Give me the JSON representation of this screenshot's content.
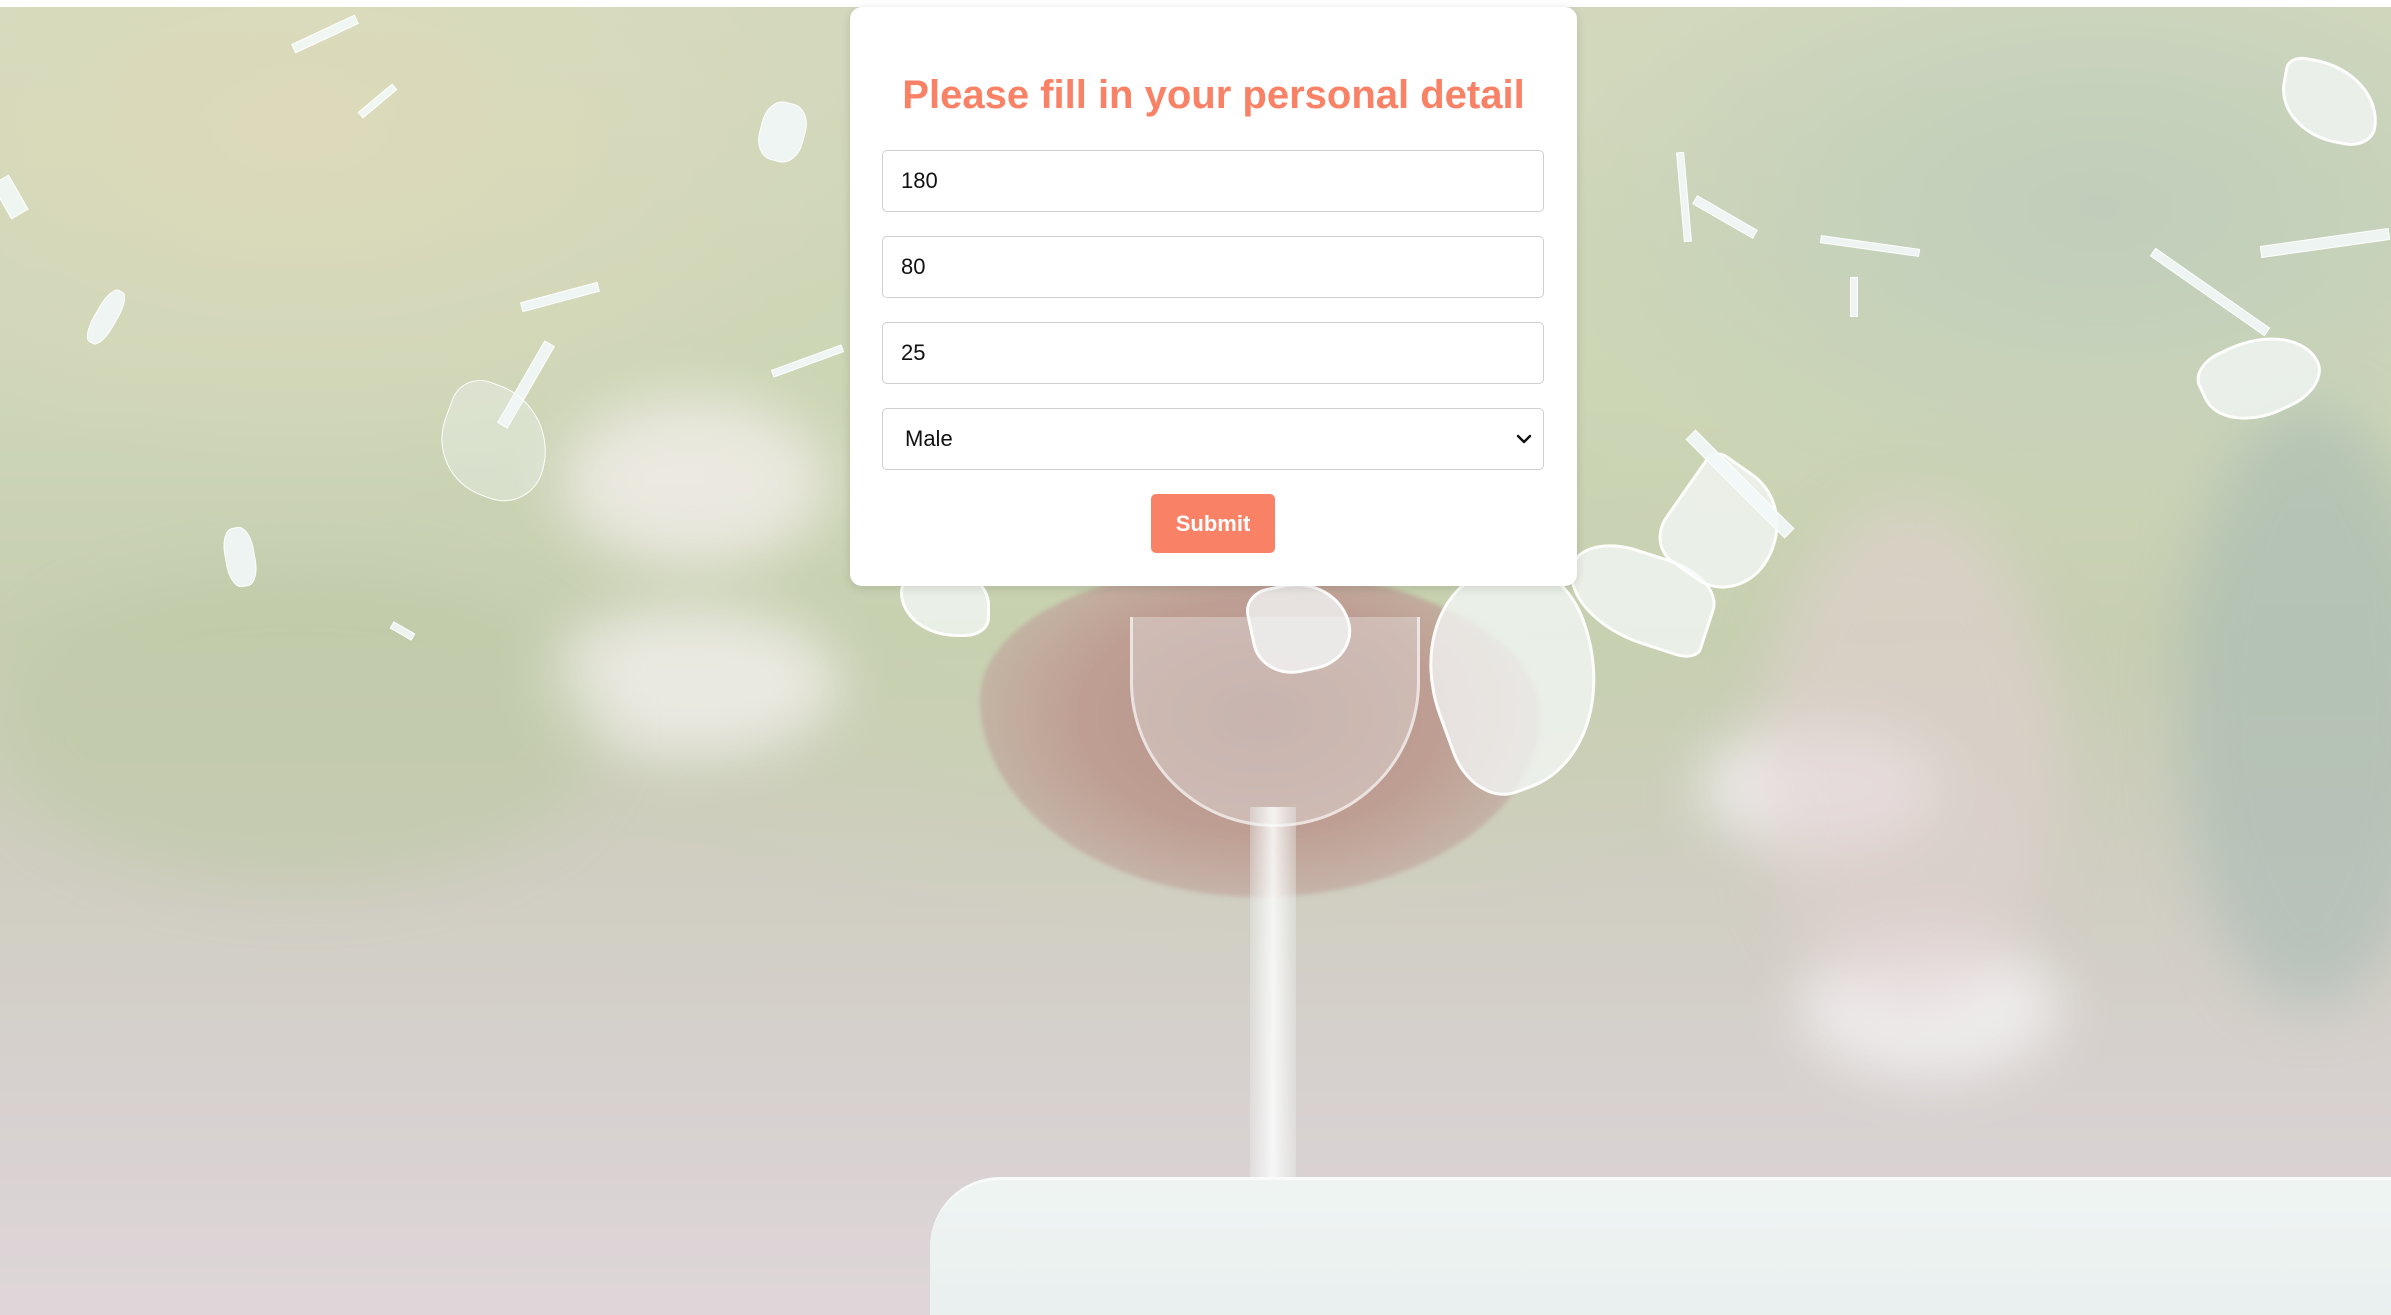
{
  "page": {
    "background_image_name": "shattering-glass-photo",
    "accent_color": "#f98266"
  },
  "form": {
    "title": "Please fill in your personal detail",
    "height_value": "180",
    "weight_value": "80",
    "age_value": "25",
    "gender_selected": "Male",
    "gender_icon": "chevron-down-icon",
    "submit_label": "Submit"
  }
}
